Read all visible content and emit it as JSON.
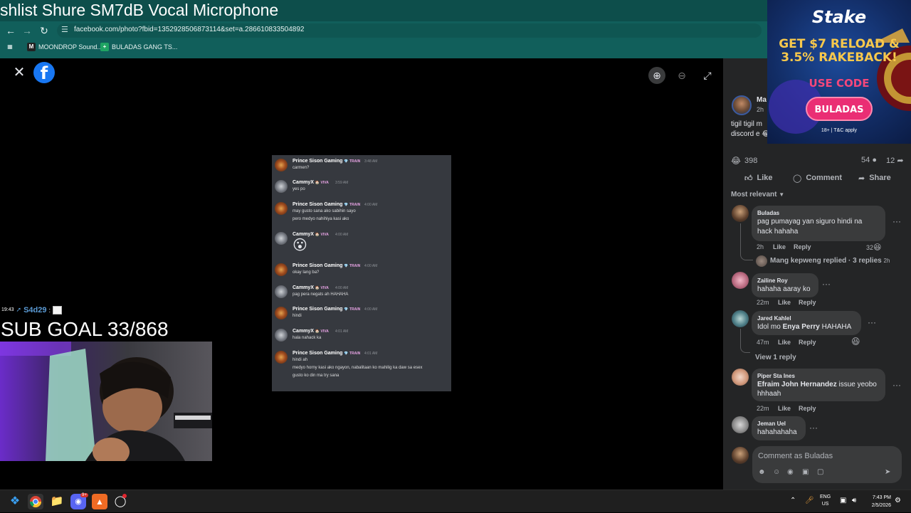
{
  "browser": {
    "overlay_title": "shlist  Shure SM7dB Vocal Microphone",
    "url": "facebook.com/photo?fbid=1352928506873114&set=a.286610833504892",
    "bookmarks": [
      {
        "label": "MOONDROP Sound..."
      },
      {
        "label": "BULADAS GANG TS..."
      }
    ]
  },
  "viewer": {
    "discord_messages": [
      {
        "author": "Prince Sison Gaming",
        "badge": "💎 TRAIN",
        "time": "3:48 AM",
        "lines": [
          "carmen?"
        ],
        "avatar": "prince"
      },
      {
        "author": "CammyX",
        "badge": "🏠 VIVA",
        "time": "3:59 AM",
        "lines": [
          "yes po"
        ],
        "avatar": "cammy"
      },
      {
        "author": "Prince Sison Gaming",
        "badge": "💎 TRAIN",
        "time": "4:00 AM",
        "lines": [
          "may gusto sana ako sabihin sayo",
          "pero medyo nahihiya kasi ako"
        ],
        "avatar": "prince"
      },
      {
        "author": "CammyX",
        "badge": "🏠 VIVA",
        "time": "4:00 AM",
        "lines": [],
        "emoji": "😮",
        "avatar": "cammy"
      },
      {
        "author": "Prince Sison Gaming",
        "badge": "💎 TRAIN",
        "time": "4:00 AM",
        "lines": [
          "okay lang ba?"
        ],
        "avatar": "prince"
      },
      {
        "author": "CammyX",
        "badge": "🏠 VIVA",
        "time": "4:00 AM",
        "lines": [
          "pag pera negats ah HAHAHA"
        ],
        "avatar": "cammy"
      },
      {
        "author": "Prince Sison Gaming",
        "badge": "💎 TRAIN",
        "time": "4:00 AM",
        "lines": [
          "hindi"
        ],
        "avatar": "prince"
      },
      {
        "author": "CammyX",
        "badge": "🏠 VIVA",
        "time": "4:01 AM",
        "lines": [
          "hala nahack ka"
        ],
        "avatar": "cammy"
      },
      {
        "author": "Prince Sison Gaming",
        "badge": "💎 TRAIN",
        "time": "4:01 AM",
        "lines": [
          "hindi ah",
          "medyo horny kasi ako ngayon, nabalitaan ko mahilig ka daw sa esex",
          "gusto ko din ma try sana"
        ],
        "avatar": "prince"
      }
    ]
  },
  "stream_overlay": {
    "chat_time": "19:43",
    "chat_user": "S4d29",
    "chat_sep": ":",
    "sub_goal": "SUB GOAL 33/868"
  },
  "post": {
    "author": "Ma",
    "time": "2h",
    "text_lines": [
      "tigil tigil m",
      "discord e 😂"
    ],
    "reactions": "398",
    "comments_count": "54",
    "shares_count": "12",
    "actions": {
      "like": "Like",
      "comment": "Comment",
      "share": "Share"
    },
    "sort_label": "Most relevant"
  },
  "comments": [
    {
      "name": "Buladas",
      "lines": [
        "pag pumayag yan siguro hindi na",
        "hack hahaha"
      ],
      "time": "2h",
      "like": "Like",
      "reply": "Reply",
      "reaction_count": "32",
      "replies_summary": "Mang kepweng replied · 3 replies",
      "replies_time": "2h"
    },
    {
      "name": "Zailine Roy",
      "lines": [
        "hahaha aaray ko"
      ],
      "time": "22m",
      "like": "Like",
      "reply": "Reply"
    },
    {
      "name": "Jared Kahlel",
      "mention": "Enya Perry",
      "prefix": "Idol mo ",
      "suffix": " HAHAHA",
      "time": "47m",
      "like": "Like",
      "reply": "Reply",
      "view_replies": "View 1 reply"
    },
    {
      "name": "Piper Sta Ines",
      "mention": "Efraim John Hernandez",
      "suffix": " issue yeobo",
      "line2": "hhhaah",
      "time": "22m",
      "like": "Like",
      "reply": "Reply"
    },
    {
      "name": "Jeman Uel",
      "lines": [
        "hahahahaha"
      ]
    }
  ],
  "comment_input": {
    "placeholder": "Comment as Buladas"
  },
  "ad": {
    "brand": "Stake",
    "headline_1": "GET $7 RELOAD &",
    "headline_2": "3.5% RAKEBACK!",
    "use_code": "USE CODE",
    "code": "BULADAS",
    "terms": "18+ | T&C apply"
  },
  "taskbar": {
    "lang_1": "ENG",
    "lang_2": "US",
    "time": "7:43 PM",
    "date": "2/5/2026",
    "discord_badge": "9+"
  }
}
